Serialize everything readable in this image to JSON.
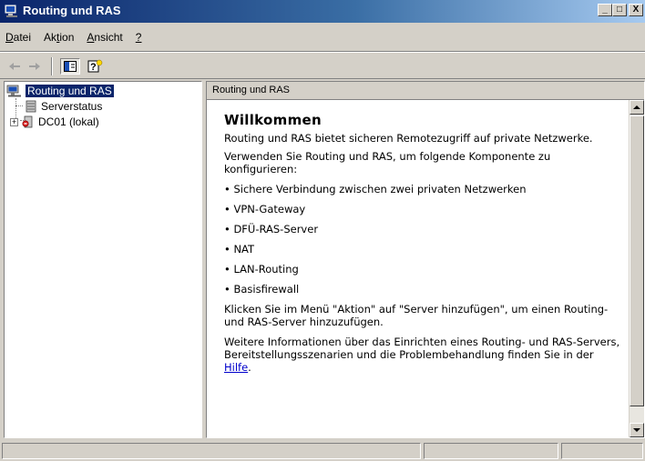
{
  "window": {
    "title": "Routing und RAS",
    "buttons": {
      "minimize": "_",
      "maximize": "□",
      "close": "X"
    }
  },
  "menu": {
    "items": [
      {
        "label": "Datei",
        "accel": "D",
        "rest": "atei"
      },
      {
        "label": "Aktion",
        "pre": "Ak",
        "accel": "t",
        "rest": "ion"
      },
      {
        "label": "Ansicht",
        "accel": "A",
        "rest": "nsicht"
      },
      {
        "label": "?",
        "accel": "?",
        "rest": ""
      }
    ]
  },
  "toolbar": {
    "icons": [
      "back-arrow-icon",
      "forward-arrow-icon",
      "show-hide-console-tree-icon",
      "help-icon"
    ]
  },
  "tree": {
    "root": {
      "label": "Routing und RAS",
      "icon": "routing-ras-icon"
    },
    "children": [
      {
        "label": "Serverstatus",
        "icon": "server-status-icon"
      },
      {
        "label": "DC01 (lokal)",
        "icon": "server-disabled-icon",
        "expander": "+"
      }
    ]
  },
  "detail": {
    "header": "Routing und RAS",
    "heading": "Willkommen",
    "intro": "Routing und RAS bietet sicheren Remotezugriff auf private Netzwerke.",
    "configure": "Verwenden Sie Routing und RAS, um folgende Komponente zu konfigurieren:",
    "bullets": [
      "Sichere Verbindung zwischen zwei privaten Netzwerken",
      "VPN-Gateway",
      "DFÜ-RAS-Server",
      "NAT",
      "LAN-Routing",
      "Basisfirewall"
    ],
    "add_server": "Klicken Sie im Menü \"Aktion\" auf \"Server hinzufügen\", um einen Routing- und RAS-Server hinzuzufügen.",
    "more_info": "Weitere Informationen über das Einrichten eines Routing- und RAS-Servers, Bereitstellungsszenarien und die Problembehandlung finden Sie in der ",
    "link": "Hilfe",
    "link_suffix": "."
  },
  "colors": {
    "titlebar_start": "#0a246a",
    "titlebar_end": "#a6caf0",
    "face": "#d4d0c8",
    "link": "#0000cc"
  }
}
